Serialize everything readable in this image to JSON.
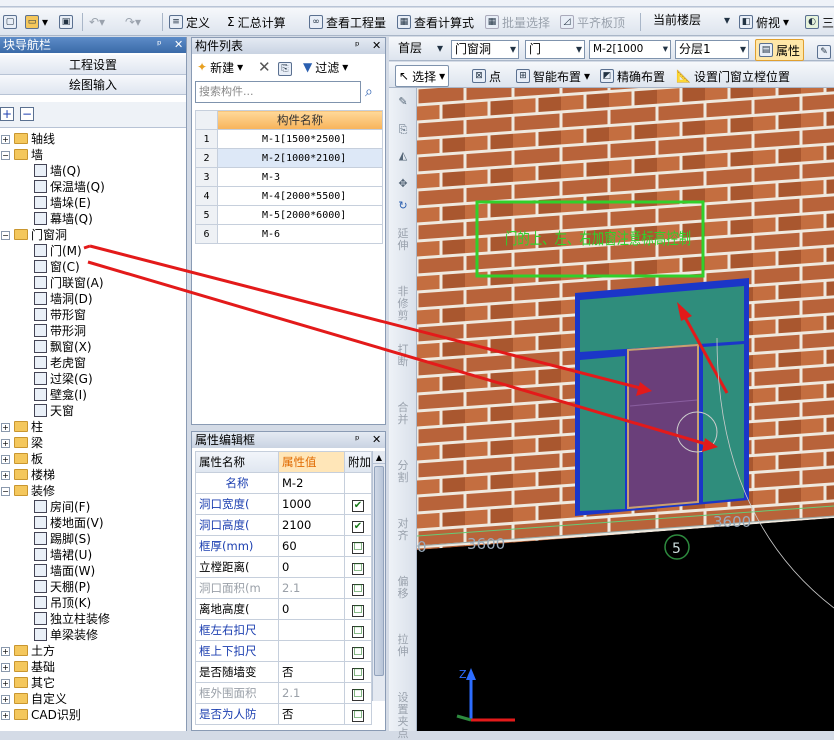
{
  "toolbar": {
    "define": "定义",
    "sum_calc": "汇总计算",
    "view_quantity": "查看工程量",
    "view_formula": "查看计算式",
    "batch_select": "批量选择",
    "flush_slab": "平齐板顶",
    "current_floor": "当前楼层",
    "view_mode": "俯视",
    "three_d": "三"
  },
  "nav": {
    "title": "块导航栏",
    "project_settings": "工程设置",
    "drawing_input": "绘图输入",
    "tree": [
      {
        "label": "轴线",
        "level": 0,
        "expand": "+"
      },
      {
        "label": "墙",
        "level": 0,
        "expand": "-"
      },
      {
        "label": "墙(Q)",
        "level": 1
      },
      {
        "label": "保温墙(Q)",
        "level": 1
      },
      {
        "label": "墙垛(E)",
        "level": 1
      },
      {
        "label": "幕墙(Q)",
        "level": 1
      },
      {
        "label": "门窗洞",
        "level": 0,
        "expand": "-"
      },
      {
        "label": "门(M)",
        "level": 1
      },
      {
        "label": "窗(C)",
        "level": 1
      },
      {
        "label": "门联窗(A)",
        "level": 1
      },
      {
        "label": "墙洞(D)",
        "level": 1
      },
      {
        "label": "带形窗",
        "level": 1
      },
      {
        "label": "带形洞",
        "level": 1
      },
      {
        "label": "飘窗(X)",
        "level": 1
      },
      {
        "label": "老虎窗",
        "level": 1
      },
      {
        "label": "过梁(G)",
        "level": 1
      },
      {
        "label": "壁龛(I)",
        "level": 1
      },
      {
        "label": "天窗",
        "level": 1
      },
      {
        "label": "柱",
        "level": 0,
        "expand": "+"
      },
      {
        "label": "梁",
        "level": 0,
        "expand": "+"
      },
      {
        "label": "板",
        "level": 0,
        "expand": "+"
      },
      {
        "label": "楼梯",
        "level": 0,
        "expand": "+"
      },
      {
        "label": "装修",
        "level": 0,
        "expand": "-"
      },
      {
        "label": "房间(F)",
        "level": 1
      },
      {
        "label": "楼地面(V)",
        "level": 1
      },
      {
        "label": "踢脚(S)",
        "level": 1
      },
      {
        "label": "墙裙(U)",
        "level": 1
      },
      {
        "label": "墙面(W)",
        "level": 1
      },
      {
        "label": "天棚(P)",
        "level": 1
      },
      {
        "label": "吊顶(K)",
        "level": 1
      },
      {
        "label": "独立柱装修",
        "level": 1
      },
      {
        "label": "单梁装修",
        "level": 1
      },
      {
        "label": "土方",
        "level": 0,
        "expand": "+"
      },
      {
        "label": "基础",
        "level": 0,
        "expand": "+"
      },
      {
        "label": "其它",
        "level": 0,
        "expand": "+"
      },
      {
        "label": "自定义",
        "level": 0,
        "expand": "+"
      },
      {
        "label": "CAD识别",
        "level": 0,
        "expand": "+"
      }
    ]
  },
  "component_list": {
    "title": "构件列表",
    "new_btn": "新建",
    "filter_btn": "过滤",
    "search_placeholder": "搜索构件...",
    "col_name": "构件名称",
    "rows": [
      {
        "no": "1",
        "name": "M-1[1500*2500]"
      },
      {
        "no": "2",
        "name": "M-2[1000*2100]"
      },
      {
        "no": "3",
        "name": "M-3"
      },
      {
        "no": "4",
        "name": "M-4[2000*5500]"
      },
      {
        "no": "5",
        "name": "M-5[2000*6000]"
      },
      {
        "no": "6",
        "name": "M-6"
      }
    ]
  },
  "properties": {
    "title": "属性编辑框",
    "col_name": "属性名称",
    "col_value": "属性值",
    "col_extra": "附加",
    "rows": [
      {
        "name": "名称",
        "value": "M-2",
        "color": "blue",
        "check": ""
      },
      {
        "name": "洞口宽度(",
        "value": "1000",
        "color": "blue",
        "check": "✔"
      },
      {
        "name": "洞口高度(",
        "value": "2100",
        "color": "blue",
        "check": "✔"
      },
      {
        "name": "框厚(mm)",
        "value": "60",
        "color": "blue",
        "check": "☐"
      },
      {
        "name": "立樘距离(",
        "value": "0",
        "color": "black",
        "check": "☐"
      },
      {
        "name": "洞口面积(m",
        "value": "2.1",
        "color": "gray",
        "check": "☐"
      },
      {
        "name": "离地高度(",
        "value": "0",
        "color": "black",
        "check": "☐"
      },
      {
        "name": "框左右扣尺",
        "value": "",
        "color": "blue",
        "check": "☐"
      },
      {
        "name": "框上下扣尺",
        "value": "",
        "color": "blue",
        "check": "☐"
      },
      {
        "name": "是否随墙变",
        "value": "否",
        "color": "black",
        "check": "☐"
      },
      {
        "name": "框外围面积",
        "value": "2.1",
        "color": "gray",
        "check": "☐"
      },
      {
        "name": "是否为人防",
        "value": "否",
        "color": "blue",
        "check": "☐"
      }
    ]
  },
  "right_toolbar": {
    "floor": "首层",
    "category": "门窗洞",
    "type": "门",
    "component": "M-2[1000",
    "layer": "分层1",
    "props_btn": "属性",
    "select_btn": "选择",
    "point_btn": "点",
    "smart_layout": "智能布置",
    "precise_layout": "精确布置",
    "set_frame_pos": "设置门窗立樘位置"
  },
  "vertical_tools": [
    "延伸",
    "非修剪",
    "打断",
    "合并",
    "分割",
    "对齐",
    "偏移",
    "拉伸",
    "设置夹点"
  ],
  "viewport": {
    "annotation": "门的上、左、右加窗注意标高控制",
    "dim_left": "3600",
    "dim_right": "3600",
    "dim_zero": "0",
    "axis_label": "5",
    "colors": {
      "brick": "#b8633a",
      "door": "#6a3f7a",
      "wall_panel": "#2f8d7c",
      "frame": "#1b36c8",
      "arrow": "#e31a1a",
      "note_box": "#31d02b"
    }
  }
}
